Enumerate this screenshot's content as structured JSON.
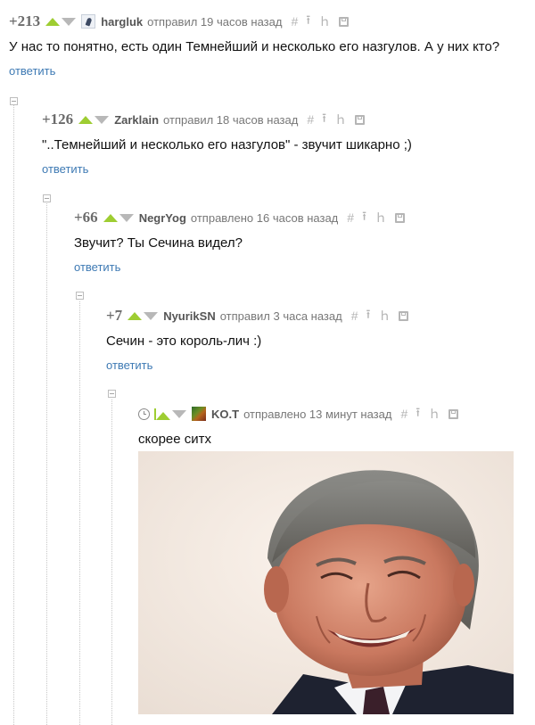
{
  "comments": [
    {
      "rating": "+213",
      "author": "hargluk",
      "meta": "отправил 19 часов назад",
      "text": "У нас то понятно, есть один Темнейший и несколько его назгулов. А у них кто?",
      "reply": "ответить",
      "avatar_icon": "avatar-icon"
    },
    {
      "rating": "+126",
      "author": "Zarklain",
      "meta": "отправил 18 часов назад",
      "text": "\"..Темнейший и несколько его назгулов\" - звучит шикарно ;)",
      "reply": "ответить"
    },
    {
      "rating": "+66",
      "author": "NegrYog",
      "meta": "отправлено 16 часов назад",
      "text": "Звучит? Ты Сечина видел?",
      "reply": "ответить"
    },
    {
      "rating": "+7",
      "author": "NyurikSN",
      "meta": "отправил 3 часа назад",
      "text": "Сечин - это король-лич :)",
      "reply": "ответить"
    },
    {
      "author": "KO.T",
      "meta": "отправлено 13 минут назад",
      "text": "скорее ситх",
      "avatar_icon": "avatar-icon",
      "time_icon": "clock-icon"
    }
  ],
  "tools": {
    "link": "#",
    "parent": "⭱",
    "branch": "ｈ",
    "save_icon": "save-icon"
  },
  "colors": {
    "vote_up": "#9ecd32",
    "vote_down": "#b8b8b8",
    "link": "#3e7ab4",
    "rating": "#6b6b6b"
  }
}
